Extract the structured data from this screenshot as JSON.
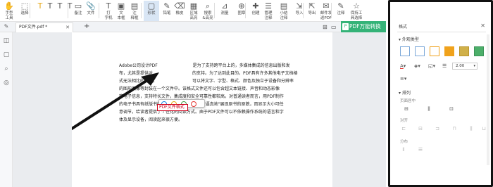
{
  "toolbar": {
    "items": [
      {
        "label": "手型\n工具",
        "icon": "hand-icon"
      },
      {
        "label": "选择",
        "icon": "cursor-icon"
      },
      {
        "label": "",
        "icon": "highlight-T-icon"
      },
      {
        "label": "",
        "icon": "underline-T-icon"
      },
      {
        "label": "",
        "icon": "strikethrough-T-icon"
      },
      {
        "label": "",
        "icon": "insert-T-icon"
      },
      {
        "label": "备注",
        "icon": "note-icon"
      },
      {
        "label": "文件",
        "icon": "file-icon"
      },
      {
        "label": "打\n字机",
        "icon": "typewriter-icon"
      },
      {
        "label": "文\n本框",
        "icon": "textbox-icon"
      },
      {
        "label": "注\n释框",
        "icon": "callout-icon"
      },
      {
        "label": "形状",
        "icon": "shape-icon"
      },
      {
        "label": "铅笔",
        "icon": "pencil-icon"
      },
      {
        "label": "橡皮",
        "icon": "eraser-icon"
      },
      {
        "label": "区域\n高亮",
        "icon": "area-highlight-icon"
      },
      {
        "label": "搜索\n&高亮",
        "icon": "search-highlight-icon"
      },
      {
        "label": "测量",
        "icon": "measure-icon"
      },
      {
        "label": "图章",
        "icon": "stamp-icon"
      },
      {
        "label": "创建\n",
        "icon": "create-icon"
      },
      {
        "label": "管理\n注释",
        "icon": "manage-annotations-icon"
      },
      {
        "label": "小结\n注释",
        "icon": "summary-icon"
      },
      {
        "label": "导入",
        "icon": "import-icon"
      },
      {
        "label": "导出",
        "icon": "export-icon"
      },
      {
        "label": "邮件发\n送PDF",
        "icon": "email-icon"
      },
      {
        "label": "注释",
        "icon": "annotation-icon"
      },
      {
        "label": "保持工\n具选择",
        "icon": "pin-icon"
      }
    ]
  },
  "tabs": {
    "active_label": "PDF文件.pdf *",
    "close": "✕",
    "add": "+"
  },
  "banner": {
    "label": "PDF万能转换"
  },
  "document": {
    "lines": [
      "Adobe公司设计PDF",
      "是为了支持跨平台上的，多媒体集成的信息出版和发",
      "布，尤其是提供对",
      "的支持。为了达到此目的，PDF具有许多其他电子文档格",
      "式无法相比的优点。",
      "可以将文字、字型、格式、颜色及独立于设备和分辨率",
      "的图形图像等封装在一个文件中。该格式文件还可以包含超文本链接、声音和动态影像",
      "等电子信息，支持特长文件，集成度和安全可靠性都较高。对普通读者而言，用PDF制作",
      "的电子书具有纸版书的质感和阅读效果，可以\"逼真地\"展现原书的原貌，而显示大小可任",
      "意调节，给读者提供了个性化的阅读方式。由于PDF文件可以不依赖操作系统的语言和字",
      "体及显示设备，阅读起来很方便。"
    ],
    "highlight_text": "PDF文件格式",
    "tooltip_colors": [
      "#1e88e5",
      "#e6a817",
      "#43a047",
      "#e53935"
    ]
  },
  "panel": {
    "tab_label": "格式",
    "close": "✕",
    "style_section": "▾ 外观类型",
    "swatches": [
      {
        "fill": "#ffffff",
        "border": "#7aa7d8"
      },
      {
        "fill": "#ffffff",
        "border": "#7aa7d8"
      },
      {
        "fill": "#ffffff",
        "border": "#f0a21c"
      },
      {
        "fill": "#f0a21c",
        "border": "#f0a21c"
      },
      {
        "fill": "#d0b049",
        "border": "#b9962e"
      },
      {
        "fill": "#4caf6a",
        "border": "#3c9458"
      }
    ],
    "line_width": "2.00",
    "arrange_section": "▾ 排列",
    "align_label": "页面居中",
    "align_sub": "对齐",
    "distribute_sub": "分布"
  }
}
